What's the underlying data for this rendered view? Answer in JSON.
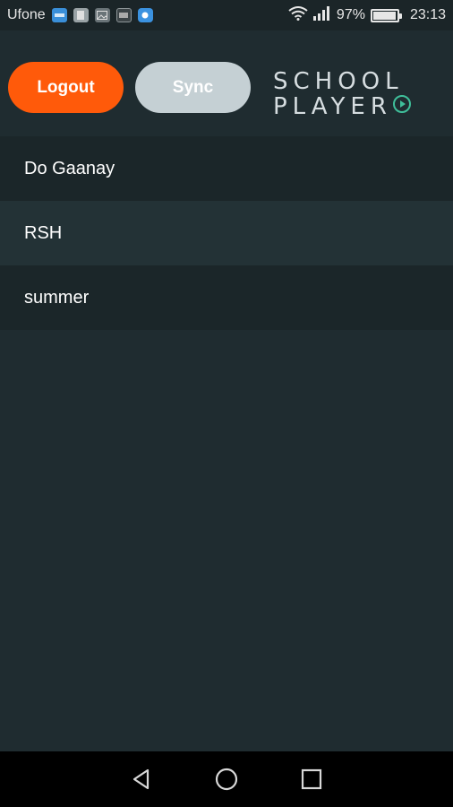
{
  "status_bar": {
    "carrier": "Ufone",
    "battery_percent": "97%",
    "battery_level": 0.97,
    "time": "23:13",
    "icons": [
      "notification-blue-icon",
      "notification-grey-icon",
      "image-notification-icon",
      "media-notification-icon",
      "message-notification-icon",
      "wifi-icon",
      "signal-icon",
      "battery-icon"
    ]
  },
  "header": {
    "logout_label": "Logout",
    "sync_label": "Sync",
    "logo_line1": "SCHOOL",
    "logo_line2": "PLAYER",
    "colors": {
      "logout": "#ff5a0a",
      "sync": "#c5d0d4",
      "logo_accent": "#3fbf9a"
    }
  },
  "playlists": [
    {
      "label": "Do Gaanay"
    },
    {
      "label": "RSH"
    },
    {
      "label": "summer"
    }
  ],
  "nav_bar": {
    "icons": [
      "back-icon",
      "home-icon",
      "recents-icon"
    ]
  }
}
